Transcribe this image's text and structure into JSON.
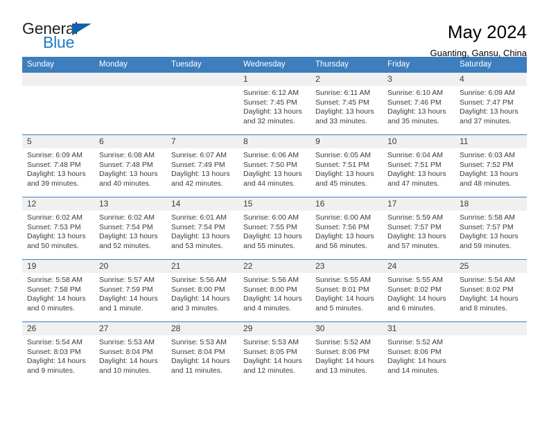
{
  "logo": {
    "word1": "General",
    "word2": "Blue",
    "triangle_color": "#1162a8",
    "blue_color": "#1f7bc1"
  },
  "header": {
    "title": "May 2024",
    "subtitle": "Guanting, Gansu, China"
  },
  "theme": {
    "header_bg": "#3d7ebe",
    "header_text": "#ffffff",
    "daynum_bg": "#f0f0f0",
    "body_text": "#3a3a3a"
  },
  "weekdays": [
    "Sunday",
    "Monday",
    "Tuesday",
    "Wednesday",
    "Thursday",
    "Friday",
    "Saturday"
  ],
  "labels": {
    "sunrise_prefix": "Sunrise: ",
    "sunset_prefix": "Sunset: ",
    "daylight_prefix": "Daylight: "
  },
  "weeks": [
    [
      {
        "day": "",
        "sunrise": "",
        "sunset": "",
        "daylight_line1": "",
        "daylight_line2": ""
      },
      {
        "day": "",
        "sunrise": "",
        "sunset": "",
        "daylight_line1": "",
        "daylight_line2": ""
      },
      {
        "day": "",
        "sunrise": "",
        "sunset": "",
        "daylight_line1": "",
        "daylight_line2": ""
      },
      {
        "day": "1",
        "sunrise": "Sunrise: 6:12 AM",
        "sunset": "Sunset: 7:45 PM",
        "daylight_line1": "Daylight: 13 hours",
        "daylight_line2": "and 32 minutes."
      },
      {
        "day": "2",
        "sunrise": "Sunrise: 6:11 AM",
        "sunset": "Sunset: 7:45 PM",
        "daylight_line1": "Daylight: 13 hours",
        "daylight_line2": "and 33 minutes."
      },
      {
        "day": "3",
        "sunrise": "Sunrise: 6:10 AM",
        "sunset": "Sunset: 7:46 PM",
        "daylight_line1": "Daylight: 13 hours",
        "daylight_line2": "and 35 minutes."
      },
      {
        "day": "4",
        "sunrise": "Sunrise: 6:09 AM",
        "sunset": "Sunset: 7:47 PM",
        "daylight_line1": "Daylight: 13 hours",
        "daylight_line2": "and 37 minutes."
      }
    ],
    [
      {
        "day": "5",
        "sunrise": "Sunrise: 6:09 AM",
        "sunset": "Sunset: 7:48 PM",
        "daylight_line1": "Daylight: 13 hours",
        "daylight_line2": "and 39 minutes."
      },
      {
        "day": "6",
        "sunrise": "Sunrise: 6:08 AM",
        "sunset": "Sunset: 7:48 PM",
        "daylight_line1": "Daylight: 13 hours",
        "daylight_line2": "and 40 minutes."
      },
      {
        "day": "7",
        "sunrise": "Sunrise: 6:07 AM",
        "sunset": "Sunset: 7:49 PM",
        "daylight_line1": "Daylight: 13 hours",
        "daylight_line2": "and 42 minutes."
      },
      {
        "day": "8",
        "sunrise": "Sunrise: 6:06 AM",
        "sunset": "Sunset: 7:50 PM",
        "daylight_line1": "Daylight: 13 hours",
        "daylight_line2": "and 44 minutes."
      },
      {
        "day": "9",
        "sunrise": "Sunrise: 6:05 AM",
        "sunset": "Sunset: 7:51 PM",
        "daylight_line1": "Daylight: 13 hours",
        "daylight_line2": "and 45 minutes."
      },
      {
        "day": "10",
        "sunrise": "Sunrise: 6:04 AM",
        "sunset": "Sunset: 7:51 PM",
        "daylight_line1": "Daylight: 13 hours",
        "daylight_line2": "and 47 minutes."
      },
      {
        "day": "11",
        "sunrise": "Sunrise: 6:03 AM",
        "sunset": "Sunset: 7:52 PM",
        "daylight_line1": "Daylight: 13 hours",
        "daylight_line2": "and 48 minutes."
      }
    ],
    [
      {
        "day": "12",
        "sunrise": "Sunrise: 6:02 AM",
        "sunset": "Sunset: 7:53 PM",
        "daylight_line1": "Daylight: 13 hours",
        "daylight_line2": "and 50 minutes."
      },
      {
        "day": "13",
        "sunrise": "Sunrise: 6:02 AM",
        "sunset": "Sunset: 7:54 PM",
        "daylight_line1": "Daylight: 13 hours",
        "daylight_line2": "and 52 minutes."
      },
      {
        "day": "14",
        "sunrise": "Sunrise: 6:01 AM",
        "sunset": "Sunset: 7:54 PM",
        "daylight_line1": "Daylight: 13 hours",
        "daylight_line2": "and 53 minutes."
      },
      {
        "day": "15",
        "sunrise": "Sunrise: 6:00 AM",
        "sunset": "Sunset: 7:55 PM",
        "daylight_line1": "Daylight: 13 hours",
        "daylight_line2": "and 55 minutes."
      },
      {
        "day": "16",
        "sunrise": "Sunrise: 6:00 AM",
        "sunset": "Sunset: 7:56 PM",
        "daylight_line1": "Daylight: 13 hours",
        "daylight_line2": "and 56 minutes."
      },
      {
        "day": "17",
        "sunrise": "Sunrise: 5:59 AM",
        "sunset": "Sunset: 7:57 PM",
        "daylight_line1": "Daylight: 13 hours",
        "daylight_line2": "and 57 minutes."
      },
      {
        "day": "18",
        "sunrise": "Sunrise: 5:58 AM",
        "sunset": "Sunset: 7:57 PM",
        "daylight_line1": "Daylight: 13 hours",
        "daylight_line2": "and 59 minutes."
      }
    ],
    [
      {
        "day": "19",
        "sunrise": "Sunrise: 5:58 AM",
        "sunset": "Sunset: 7:58 PM",
        "daylight_line1": "Daylight: 14 hours",
        "daylight_line2": "and 0 minutes."
      },
      {
        "day": "20",
        "sunrise": "Sunrise: 5:57 AM",
        "sunset": "Sunset: 7:59 PM",
        "daylight_line1": "Daylight: 14 hours",
        "daylight_line2": "and 1 minute."
      },
      {
        "day": "21",
        "sunrise": "Sunrise: 5:56 AM",
        "sunset": "Sunset: 8:00 PM",
        "daylight_line1": "Daylight: 14 hours",
        "daylight_line2": "and 3 minutes."
      },
      {
        "day": "22",
        "sunrise": "Sunrise: 5:56 AM",
        "sunset": "Sunset: 8:00 PM",
        "daylight_line1": "Daylight: 14 hours",
        "daylight_line2": "and 4 minutes."
      },
      {
        "day": "23",
        "sunrise": "Sunrise: 5:55 AM",
        "sunset": "Sunset: 8:01 PM",
        "daylight_line1": "Daylight: 14 hours",
        "daylight_line2": "and 5 minutes."
      },
      {
        "day": "24",
        "sunrise": "Sunrise: 5:55 AM",
        "sunset": "Sunset: 8:02 PM",
        "daylight_line1": "Daylight: 14 hours",
        "daylight_line2": "and 6 minutes."
      },
      {
        "day": "25",
        "sunrise": "Sunrise: 5:54 AM",
        "sunset": "Sunset: 8:02 PM",
        "daylight_line1": "Daylight: 14 hours",
        "daylight_line2": "and 8 minutes."
      }
    ],
    [
      {
        "day": "26",
        "sunrise": "Sunrise: 5:54 AM",
        "sunset": "Sunset: 8:03 PM",
        "daylight_line1": "Daylight: 14 hours",
        "daylight_line2": "and 9 minutes."
      },
      {
        "day": "27",
        "sunrise": "Sunrise: 5:53 AM",
        "sunset": "Sunset: 8:04 PM",
        "daylight_line1": "Daylight: 14 hours",
        "daylight_line2": "and 10 minutes."
      },
      {
        "day": "28",
        "sunrise": "Sunrise: 5:53 AM",
        "sunset": "Sunset: 8:04 PM",
        "daylight_line1": "Daylight: 14 hours",
        "daylight_line2": "and 11 minutes."
      },
      {
        "day": "29",
        "sunrise": "Sunrise: 5:53 AM",
        "sunset": "Sunset: 8:05 PM",
        "daylight_line1": "Daylight: 14 hours",
        "daylight_line2": "and 12 minutes."
      },
      {
        "day": "30",
        "sunrise": "Sunrise: 5:52 AM",
        "sunset": "Sunset: 8:06 PM",
        "daylight_line1": "Daylight: 14 hours",
        "daylight_line2": "and 13 minutes."
      },
      {
        "day": "31",
        "sunrise": "Sunrise: 5:52 AM",
        "sunset": "Sunset: 8:06 PM",
        "daylight_line1": "Daylight: 14 hours",
        "daylight_line2": "and 14 minutes."
      },
      {
        "day": "",
        "sunrise": "",
        "sunset": "",
        "daylight_line1": "",
        "daylight_line2": ""
      }
    ]
  ]
}
